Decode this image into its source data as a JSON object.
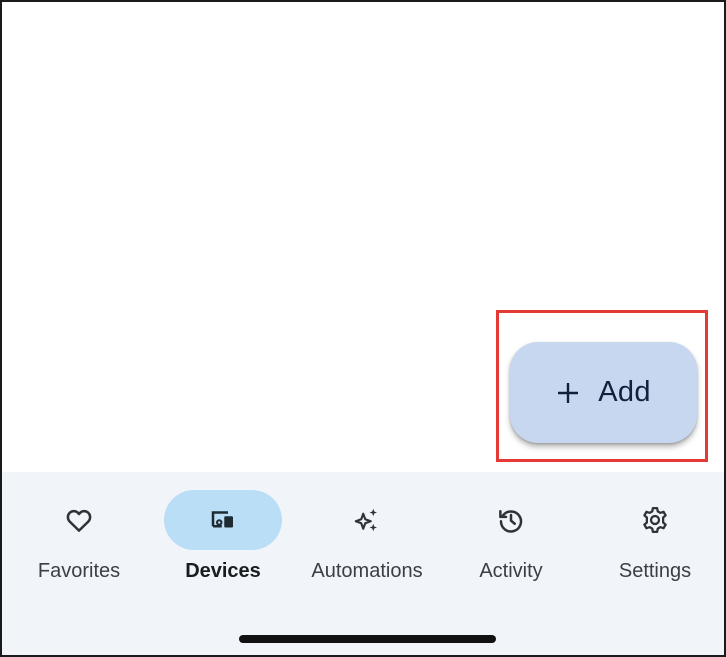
{
  "fab": {
    "label": "Add",
    "icon": "plus-icon"
  },
  "nav": {
    "items": [
      {
        "label": "Favorites",
        "icon": "heart-icon",
        "active": false
      },
      {
        "label": "Devices",
        "icon": "devices-icon",
        "active": true
      },
      {
        "label": "Automations",
        "icon": "sparkle-icon",
        "active": false
      },
      {
        "label": "Activity",
        "icon": "history-icon",
        "active": false
      },
      {
        "label": "Settings",
        "icon": "gear-icon",
        "active": false
      }
    ]
  },
  "colors": {
    "fab_bg": "#c7d7ef",
    "nav_bg": "#f1f5fa",
    "active_indicator": "#b9def5",
    "highlight": "#e53935"
  }
}
